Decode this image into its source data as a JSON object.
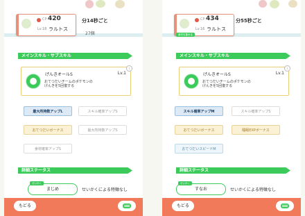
{
  "colors": {
    "accent_green": "#3ccb5b",
    "footer_orange": "#f07a59",
    "card_border": "#e8917a",
    "skill_border": "#e8cf77"
  },
  "panels": [
    {
      "pokemon": {
        "cp_label": "CP",
        "cp": "420",
        "level_label": "Lv.18",
        "name": "ラルトス"
      },
      "help_time": "分14秒ごと",
      "ingredient_count": "27個",
      "section_main_skill": "メインスキル・サブスキル",
      "main_skill": {
        "name": "げんきオールS",
        "level": "Lv.1",
        "description": "おてつだいチームのポケモンの\nげんきを5回復する"
      },
      "sub_skills": [
        {
          "label": "最大所持数アップL",
          "style": "sel"
        },
        {
          "label": "スキル確率アップS",
          "style": "off"
        },
        {
          "label": "おてつだいボーナス",
          "style": "yel"
        },
        {
          "label": "最大所持数アップS",
          "style": "off"
        },
        {
          "label": "食材確率アップS",
          "style": "off"
        }
      ],
      "section_status": "詳細ステータス",
      "nature": {
        "tag": "せいかく",
        "name": "まじめ",
        "effect": "せいかくによる特徴なし"
      },
      "footer": {
        "back": "もどる"
      }
    },
    {
      "pokemon": {
        "cp_label": "CP",
        "cp": "434",
        "level_label": "Lv.16",
        "name": "ラルトス"
      },
      "help_time": "分55秒ごと",
      "ingredient_label": "食材を集める",
      "section_main_skill": "メインスキル・サブスキル",
      "main_skill": {
        "name": "げんきオールS",
        "level": "Lv.1",
        "description": "おてつだいチームのポケモンの\nげんきを5回復する"
      },
      "sub_skills": [
        {
          "label": "スキル確率アップM",
          "style": "sel"
        },
        {
          "label": "スキル確率アップS",
          "style": "off"
        },
        {
          "label": "おてつだいボーナス",
          "style": "yel"
        },
        {
          "label": "睡眠EXPボーナス",
          "style": "yel"
        },
        {
          "label": "おてつだいスピードM",
          "style": "blue"
        }
      ],
      "section_status": "詳細ステータス",
      "nature": {
        "tag": "せいかく",
        "name": "すなお",
        "effect": "せいかくによる特徴なし"
      },
      "footer": {
        "back": "もどる"
      }
    }
  ]
}
